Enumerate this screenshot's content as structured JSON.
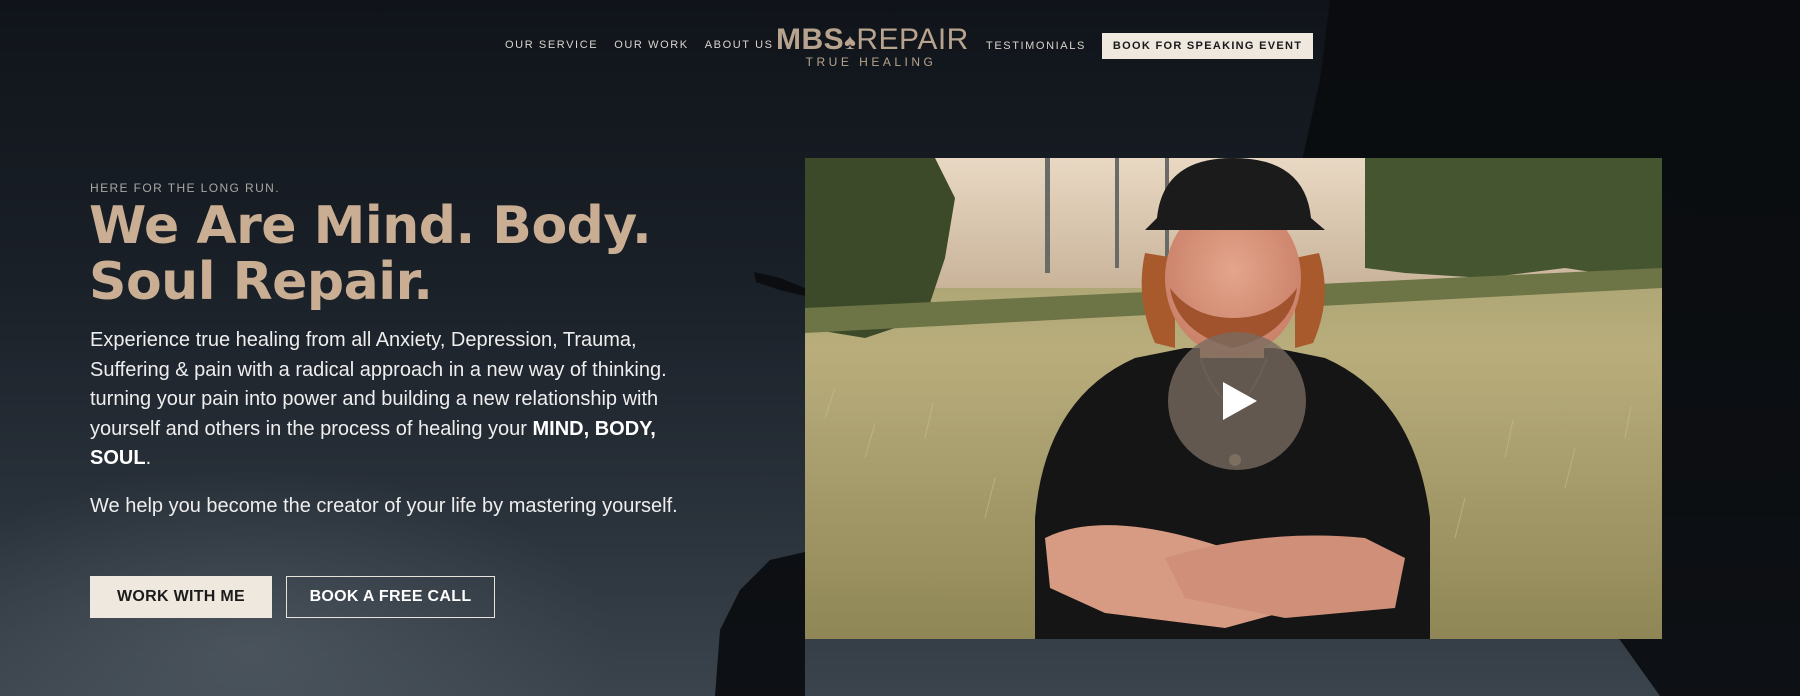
{
  "nav": {
    "left_links": [
      "OUR SERVICE",
      "OUR WORK",
      "ABOUT US"
    ],
    "right_links": [
      "TESTIMONIALS"
    ],
    "cta": "BOOK FOR SPEAKING EVENT",
    "logo_text_left": "MBS",
    "logo_text_right": "REPAIR",
    "logo_tagline": "TRUE HEALING"
  },
  "hero": {
    "eyebrow": "HERE FOR THE LONG RUN.",
    "headline_line1": "We Are Mind. Body.",
    "headline_line2": "Soul Repair.",
    "body_prefix": "Experience true healing from all Anxiety, Depression, Trauma, Suffering & pain with a radical approach in a new way of thinking. turning your pain into power and building a new relationship with yourself and others in the process of healing your ",
    "body_emphasis": "MIND, BODY, SOUL",
    "body_suffix": ".",
    "body_second": "We help you become the creator of your life by mastering yourself.",
    "primary_button": "WORK WITH ME",
    "secondary_button": "BOOK A FREE CALL"
  },
  "video": {
    "play_icon": "play-icon"
  },
  "colors": {
    "accent": "#c9ae93",
    "logo": "#b8a48e",
    "button_light": "#efe8df",
    "background_dark": "#10141a"
  }
}
